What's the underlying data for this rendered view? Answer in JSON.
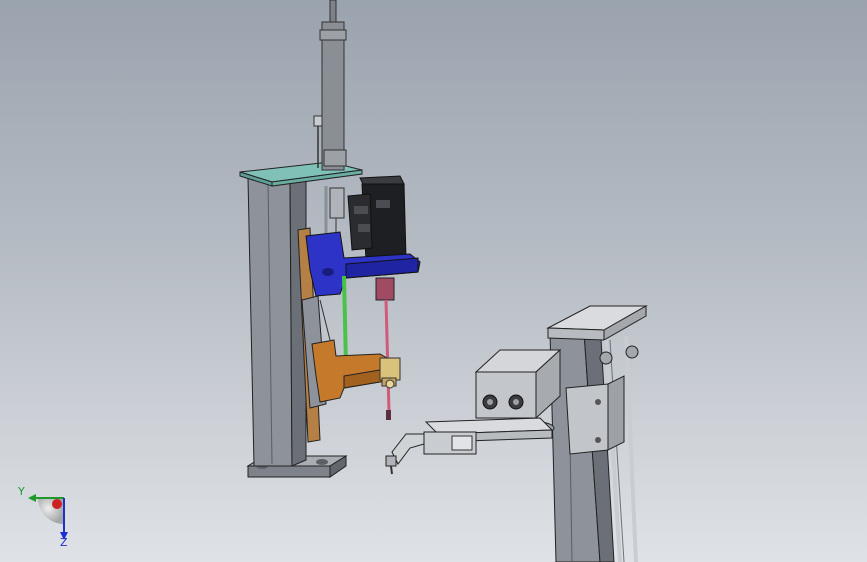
{
  "viewport": {
    "background_top": "#9aa3ae",
    "background_bottom": "#dfe2e6"
  },
  "model": {
    "colors": {
      "frame_gray": "#8d929b",
      "frame_dark": "#5f646c",
      "cyan_plate": "#7fc1b6",
      "blue_bracket": "#2e33c8",
      "orange_block": "#c57a2b",
      "green_rod": "#49c24a",
      "pink_rod": "#d05a7a",
      "black_motor": "#1e1f22",
      "light_part": "#d9dbde"
    }
  },
  "triad": {
    "y_label": "Y",
    "z_label": "Z",
    "y_color": "#1f9a2a",
    "z_color": "#1e2fd0",
    "origin_color": "#cc2222"
  }
}
